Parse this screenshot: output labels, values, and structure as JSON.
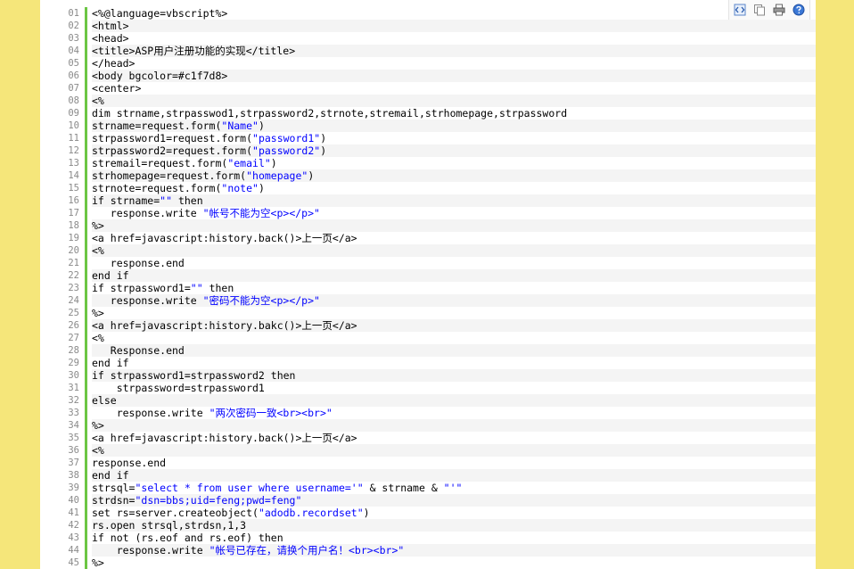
{
  "toolbar": {
    "icons": [
      "view-source-icon",
      "copy-icon",
      "print-icon",
      "help-icon"
    ]
  },
  "code_lines": [
    {
      "n": "01",
      "t": "<%@language=vbscript%>"
    },
    {
      "n": "02",
      "t": "<html>"
    },
    {
      "n": "03",
      "t": "<head>"
    },
    {
      "n": "04",
      "t": "<title>ASP用户注册功能的实现</title>"
    },
    {
      "n": "05",
      "t": "</head>"
    },
    {
      "n": "06",
      "t": "<body bgcolor=#c1f7d8>"
    },
    {
      "n": "07",
      "t": "<center>"
    },
    {
      "n": "08",
      "t": "<%"
    },
    {
      "n": "09",
      "t": "dim strname,strpasswod1,strpassword2,strnote,stremail,strhomepage,strpassword"
    },
    {
      "n": "10",
      "t": "strname=request.form(\"Name\")"
    },
    {
      "n": "11",
      "t": "strpassword1=request.form(\"password1\")"
    },
    {
      "n": "12",
      "t": "strpassword2=request.form(\"password2\")"
    },
    {
      "n": "13",
      "t": "stremail=request.form(\"email\")"
    },
    {
      "n": "14",
      "t": "strhomepage=request.form(\"homepage\")"
    },
    {
      "n": "15",
      "t": "strnote=request.form(\"note\")"
    },
    {
      "n": "16",
      "t": "if strname=\"\" then"
    },
    {
      "n": "17",
      "t": "   response.write \"帐号不能为空<p></p>\""
    },
    {
      "n": "18",
      "t": "%>"
    },
    {
      "n": "19",
      "t": "<a href=javascript:history.back()>上一页</a>"
    },
    {
      "n": "20",
      "t": "<%"
    },
    {
      "n": "21",
      "t": "   response.end"
    },
    {
      "n": "22",
      "t": "end if"
    },
    {
      "n": "23",
      "t": "if strpassword1=\"\" then"
    },
    {
      "n": "24",
      "t": "   response.write \"密码不能为空<p></p>\""
    },
    {
      "n": "25",
      "t": "%>"
    },
    {
      "n": "26",
      "t": "<a href=javascript:history.bakc()>上一页</a>"
    },
    {
      "n": "27",
      "t": "<%"
    },
    {
      "n": "28",
      "t": "   Response.end"
    },
    {
      "n": "29",
      "t": "end if"
    },
    {
      "n": "30",
      "t": "if strpassword1=strpassword2 then"
    },
    {
      "n": "31",
      "t": "    strpassword=strpassword1"
    },
    {
      "n": "32",
      "t": "else"
    },
    {
      "n": "33",
      "t": "    response.write \"两次密码一致<br><br>\""
    },
    {
      "n": "34",
      "t": "%>"
    },
    {
      "n": "35",
      "t": "<a href=javascript:history.back()>上一页</a>"
    },
    {
      "n": "36",
      "t": "<%"
    },
    {
      "n": "37",
      "t": "response.end"
    },
    {
      "n": "38",
      "t": "end if"
    },
    {
      "n": "39",
      "t": "strsql=\"select * from user where username='\" & strname & \"'\""
    },
    {
      "n": "40",
      "t": "strdsn=\"dsn=bbs;uid=feng;pwd=feng\""
    },
    {
      "n": "41",
      "t": "set rs=server.createobject(\"adodb.recordset\")"
    },
    {
      "n": "42",
      "t": "rs.open strsql,strdsn,1,3"
    },
    {
      "n": "43",
      "t": "if not (rs.eof and rs.eof) then"
    },
    {
      "n": "44",
      "t": "    response.write \"帐号已存在，请换个用户名！<br><br>\""
    },
    {
      "n": "45",
      "t": "%>"
    }
  ],
  "colors": {
    "background": "#f5e67a",
    "gutter_bar": "#6cc644",
    "string": "#0000ff",
    "line_number": "#8a8a8a"
  }
}
